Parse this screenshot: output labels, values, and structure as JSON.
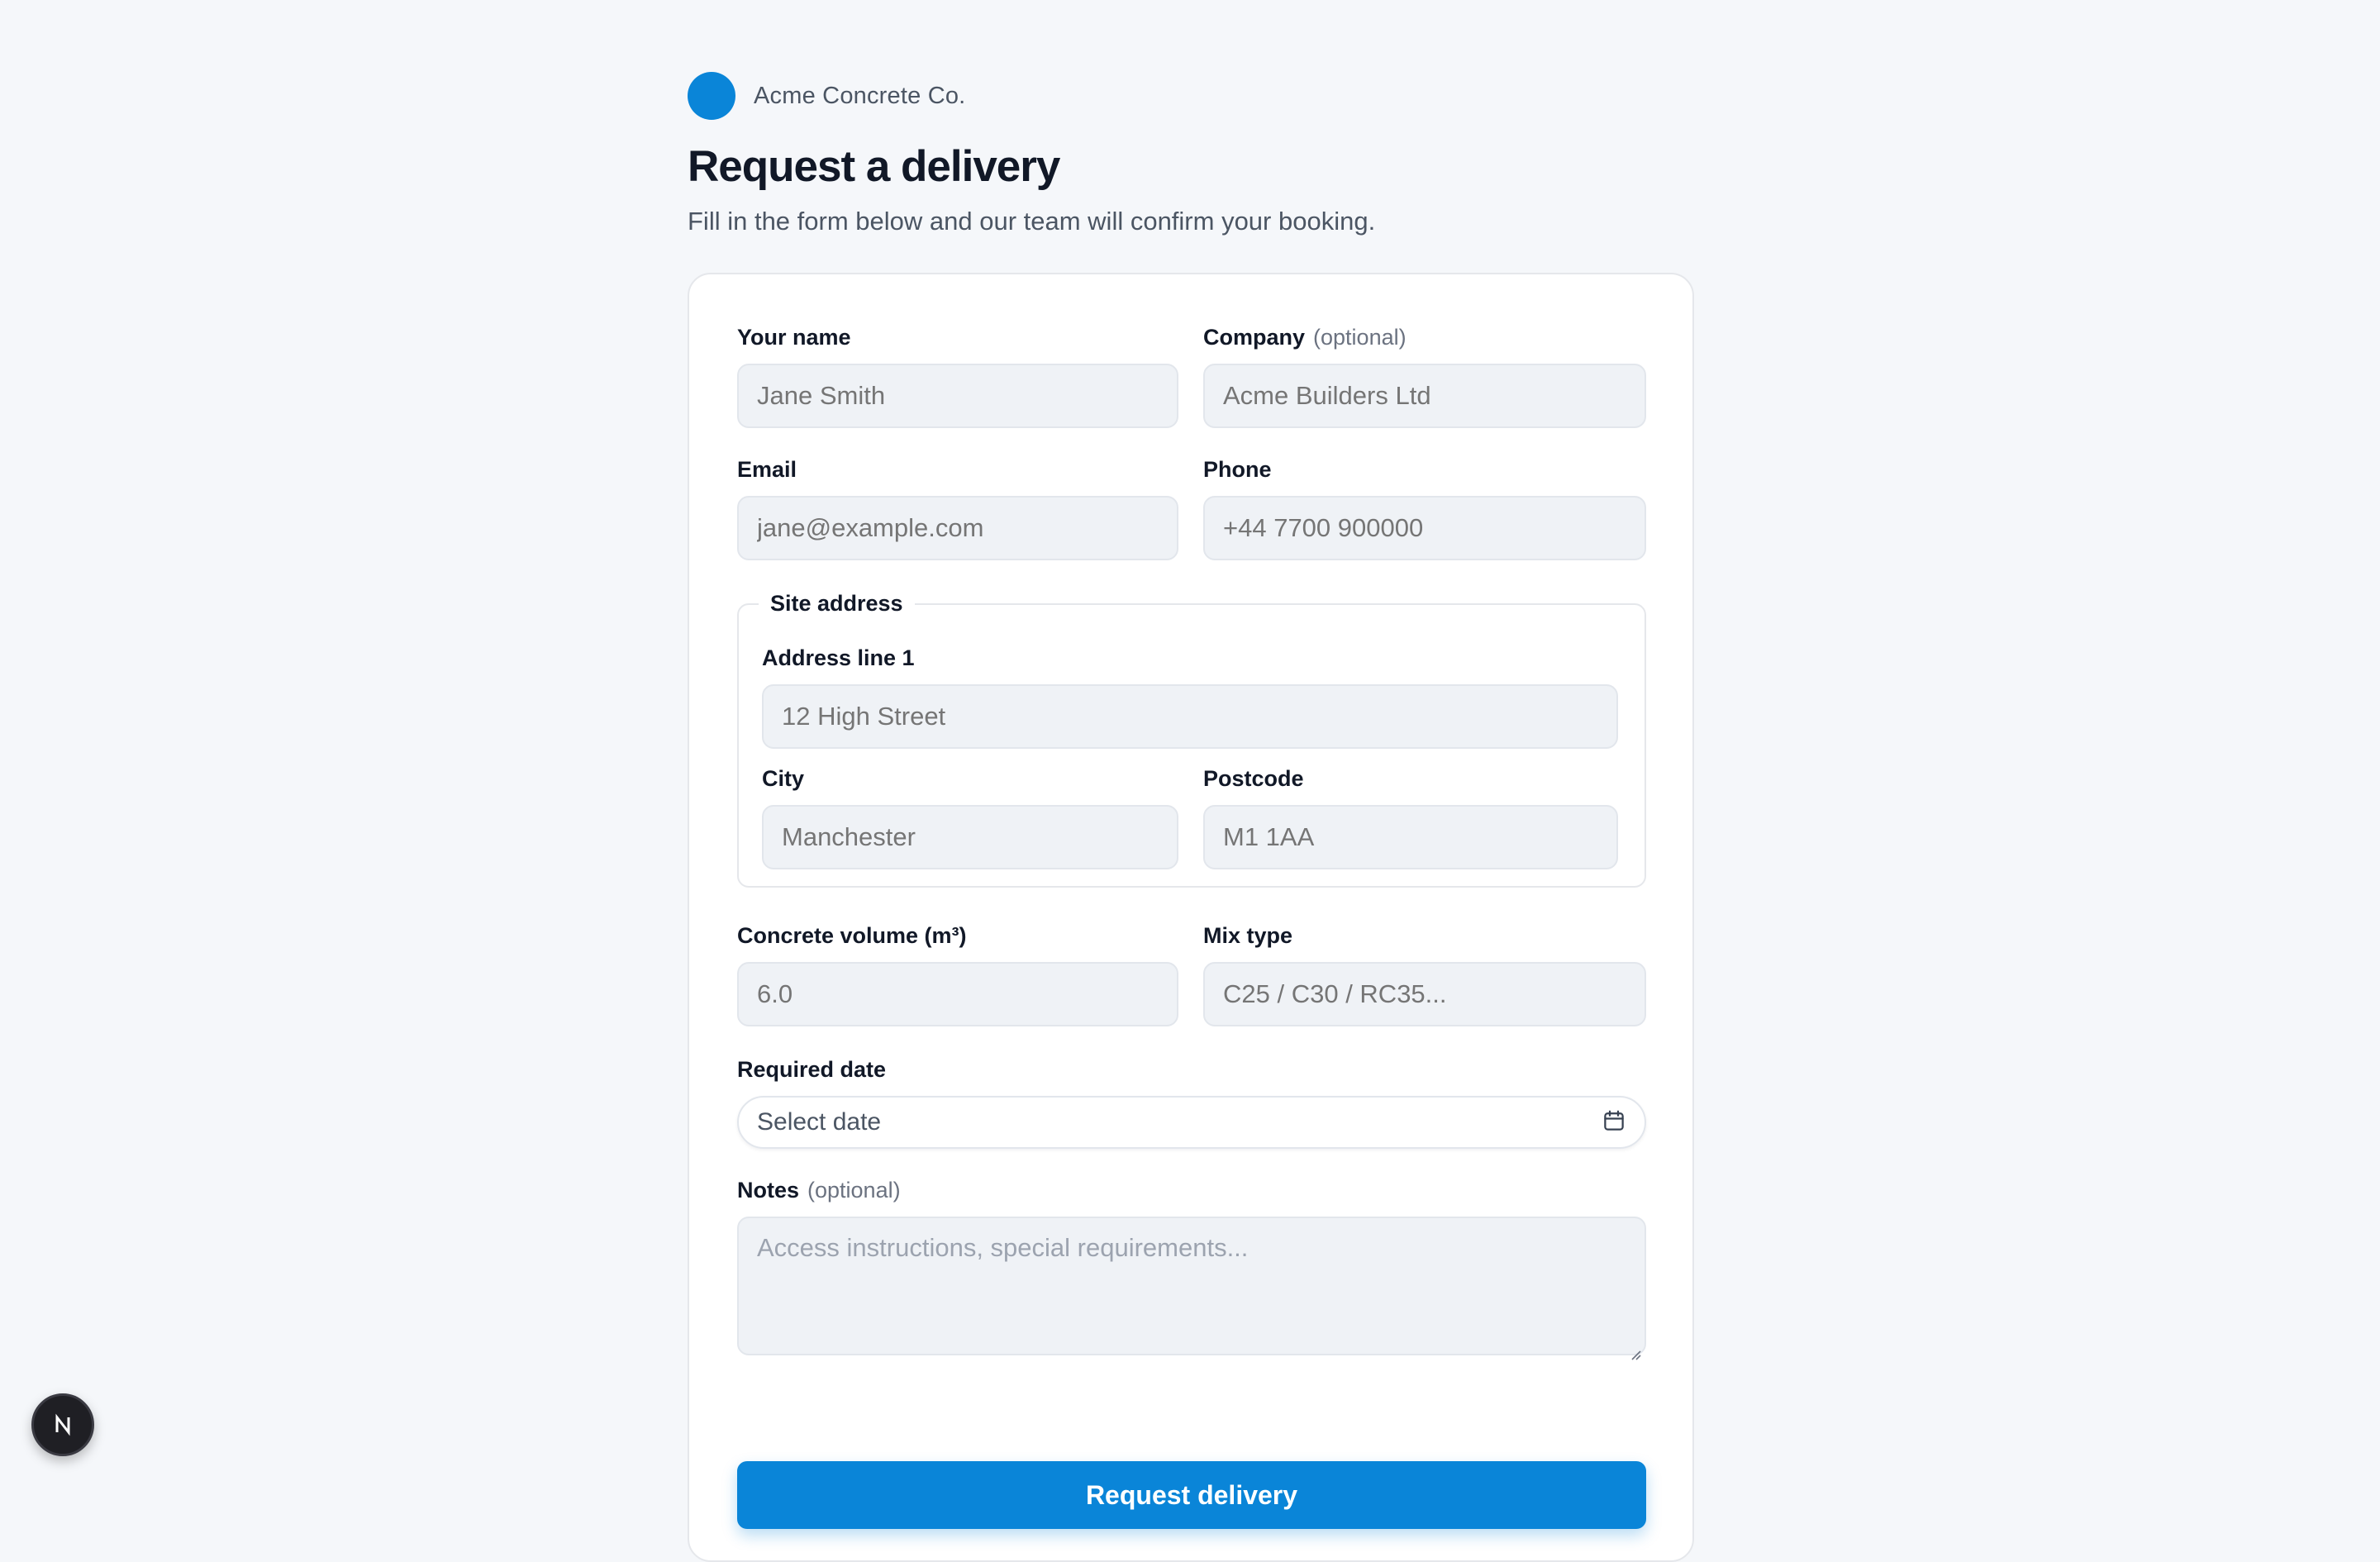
{
  "brand": {
    "name": "Acme Concrete Co.",
    "color": "#0a85d8"
  },
  "header": {
    "title": "Request a delivery",
    "subtitle": "Fill in the form below and our team will confirm your booking."
  },
  "form": {
    "name": {
      "label": "Your name",
      "placeholder": "Jane Smith",
      "value": ""
    },
    "company": {
      "label": "Company",
      "optional": "(optional)",
      "placeholder": "Acme Builders Ltd",
      "value": ""
    },
    "email": {
      "label": "Email",
      "placeholder": "jane@example.com",
      "value": ""
    },
    "phone": {
      "label": "Phone",
      "placeholder": "+44 7700 900000",
      "value": ""
    },
    "site_address": {
      "legend": "Site address",
      "address1": {
        "label": "Address line 1",
        "placeholder": "12 High Street",
        "value": ""
      },
      "city": {
        "label": "City",
        "placeholder": "Manchester",
        "value": ""
      },
      "postcode": {
        "label": "Postcode",
        "placeholder": "M1 1AA",
        "value": ""
      }
    },
    "volume": {
      "label": "Concrete volume (m³)",
      "placeholder": "6.0",
      "value": ""
    },
    "mix": {
      "label": "Mix type",
      "placeholder": "C25 / C30 / RC35...",
      "value": ""
    },
    "date": {
      "label": "Required date",
      "placeholder": "Select date",
      "icon": "calendar-icon"
    },
    "notes": {
      "label": "Notes",
      "optional": "(optional)",
      "placeholder": "Access instructions, special requirements...",
      "value": ""
    },
    "submit_label": "Request delivery"
  },
  "dev_badge": {
    "letter": "N",
    "icon": "nextjs-logo-icon"
  }
}
